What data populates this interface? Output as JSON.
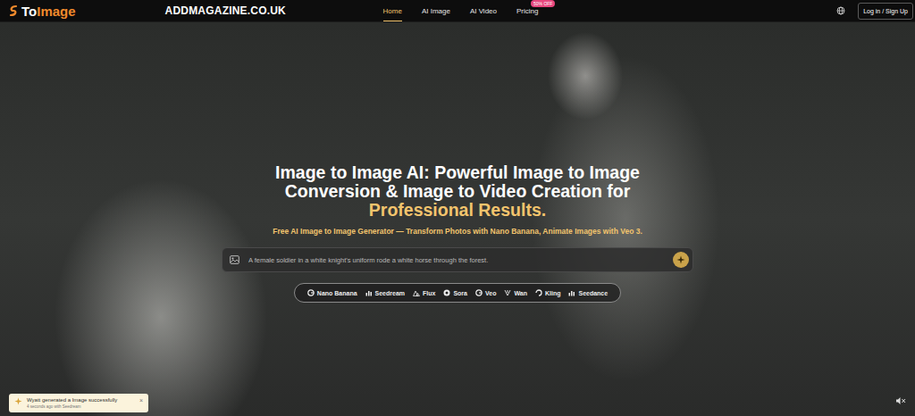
{
  "logo": {
    "parts": [
      "To",
      "Image"
    ]
  },
  "watermark": "ADDMAGAZINE.CO.UK",
  "nav": [
    {
      "label": "Home",
      "selected": true
    },
    {
      "label": "AI Image",
      "selected": false
    },
    {
      "label": "AI Video",
      "selected": false
    },
    {
      "label": "Pricing",
      "selected": false,
      "badge": "50% OFF"
    }
  ],
  "login": "Log in / Sign Up",
  "hero": {
    "title": "Image to Image AI: Powerful Image to Image Conversion & Image to Video Creation for",
    "title_highlight": "Professional Results.",
    "subtitle": "Free AI Image to Image Generator — Transform Photos with Nano Banana, Animate Images with Veo 3."
  },
  "prompt": {
    "placeholder": "A female soldier in a white knight's uniform rode a white horse through the forest."
  },
  "models": [
    {
      "label": "Nano Banana"
    },
    {
      "label": "Seedream"
    },
    {
      "label": "Flux"
    },
    {
      "label": "Sora"
    },
    {
      "label": "Veo"
    },
    {
      "label": "Wan"
    },
    {
      "label": "Kling"
    },
    {
      "label": "Seedance"
    }
  ],
  "toast": {
    "title": "Wyatt generated a Image successfully",
    "subtitle": "4 seconds ago with Seedream",
    "close": "×"
  }
}
